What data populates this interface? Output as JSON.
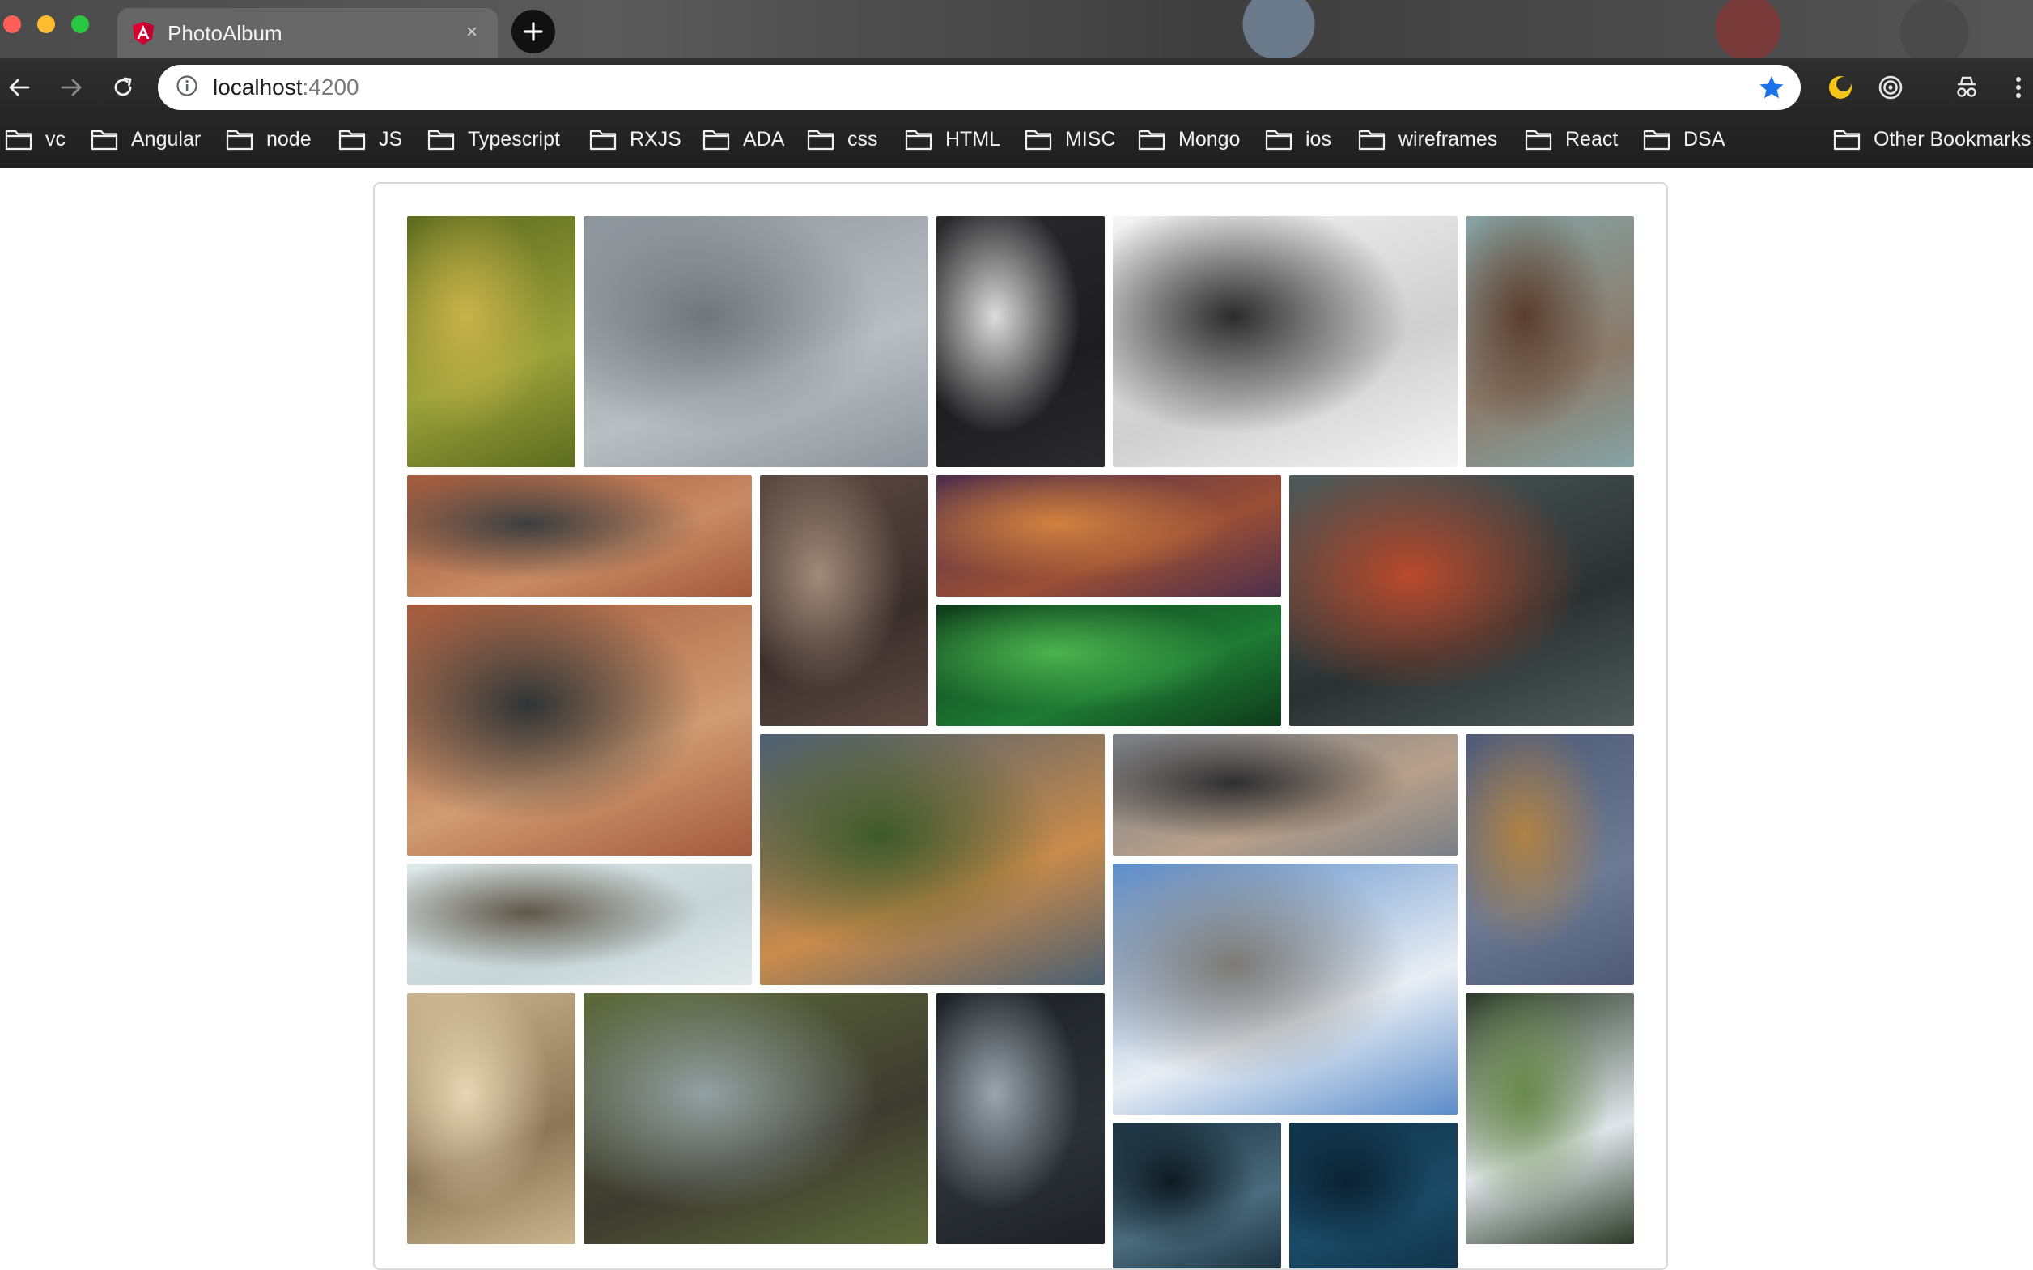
{
  "window": {
    "tab_title": "PhotoAlbum",
    "tab_close": "×"
  },
  "omnibox": {
    "host": "localhost",
    "port": ":4200"
  },
  "bookmarks": [
    {
      "label": "vc"
    },
    {
      "label": "Angular"
    },
    {
      "label": "node"
    },
    {
      "label": "JS"
    },
    {
      "label": "Typescript"
    },
    {
      "label": "RXJS"
    },
    {
      "label": "ADA"
    },
    {
      "label": "css"
    },
    {
      "label": "HTML"
    },
    {
      "label": "MISC"
    },
    {
      "label": "Mongo"
    },
    {
      "label": "ios"
    },
    {
      "label": "wireframes"
    },
    {
      "label": "React"
    },
    {
      "label": "DSA"
    },
    {
      "label": "Other Bookmarks"
    }
  ],
  "colors": {
    "accent_star": "#1a73e8",
    "angular_red": "#dd0031",
    "traffic_close": "#ff5f57",
    "traffic_min": "#febc2e",
    "traffic_max": "#28c840"
  },
  "gallery": {
    "photos": [
      {
        "name": "photo-moss-tree",
        "colors": [
          "#5c6b1f",
          "#9aa23a",
          "#c9b24a"
        ]
      },
      {
        "name": "photo-seagulls-swans",
        "colors": [
          "#8c949b",
          "#b9bec2",
          "#6f767c"
        ]
      },
      {
        "name": "photo-tunnel-silhouette",
        "colors": [
          "#2a2a2c",
          "#1d1d1f",
          "#dcdcdc"
        ]
      },
      {
        "name": "photo-feet-bw",
        "colors": [
          "#f4f4f4",
          "#cfcfcf",
          "#2b2b2b"
        ]
      },
      {
        "name": "photo-volcano-mountain",
        "colors": [
          "#86a3a4",
          "#8b7a6a",
          "#5a3d2e"
        ]
      },
      {
        "name": "photo-leather-wallet-1",
        "colors": [
          "#a35a3c",
          "#c88a64",
          "#3b3f41"
        ]
      },
      {
        "name": "photo-husky-dog",
        "colors": [
          "#5d4a42",
          "#3a2e2b",
          "#a08a7a"
        ]
      },
      {
        "name": "photo-desert-sunset",
        "colors": [
          "#4d2f4b",
          "#9a4f36",
          "#d1813f"
        ]
      },
      {
        "name": "photo-rain-window",
        "colors": [
          "#4f5a5a",
          "#2b3233",
          "#b9492c"
        ]
      },
      {
        "name": "photo-aurora",
        "colors": [
          "#0f3a1b",
          "#1e7a34",
          "#4cb34f"
        ]
      },
      {
        "name": "photo-leather-wallet-2",
        "colors": [
          "#a35a3c",
          "#d09b72",
          "#2f3436"
        ]
      },
      {
        "name": "photo-tree-avenue",
        "colors": [
          "#4b5f72",
          "#c98b4b",
          "#3e5a2a"
        ]
      },
      {
        "name": "photo-camera-hands",
        "colors": [
          "#7a7f86",
          "#b7a08b",
          "#2f2f31"
        ]
      },
      {
        "name": "photo-sand-dunes",
        "colors": [
          "#4e5a76",
          "#6c7a94",
          "#b08244"
        ]
      },
      {
        "name": "photo-blurred-tower",
        "colors": [
          "#dfe9ea",
          "#c7d5d7",
          "#5f574a"
        ]
      },
      {
        "name": "photo-city-clouds",
        "colors": [
          "#5c8cc9",
          "#e9eef4",
          "#7c7a76"
        ]
      },
      {
        "name": "photo-deer",
        "colors": [
          "#c9b48e",
          "#8b7656",
          "#e7d6b3"
        ]
      },
      {
        "name": "photo-canyon-river",
        "colors": [
          "#5d6a3a",
          "#3d3b30",
          "#93a0a2"
        ]
      },
      {
        "name": "photo-cn-tower",
        "colors": [
          "#1e2226",
          "#2c3136",
          "#9aa6ad"
        ]
      },
      {
        "name": "photo-waterfall",
        "colors": [
          "#2b3a28",
          "#dfe6ea",
          "#6a8a4a"
        ]
      },
      {
        "name": "photo-dark-clouds",
        "colors": [
          "#1d3442",
          "#4b6c7e",
          "#0e1a22"
        ]
      },
      {
        "name": "photo-night-sky",
        "colors": [
          "#11344a",
          "#1b4a66",
          "#0b2233"
        ]
      }
    ]
  }
}
